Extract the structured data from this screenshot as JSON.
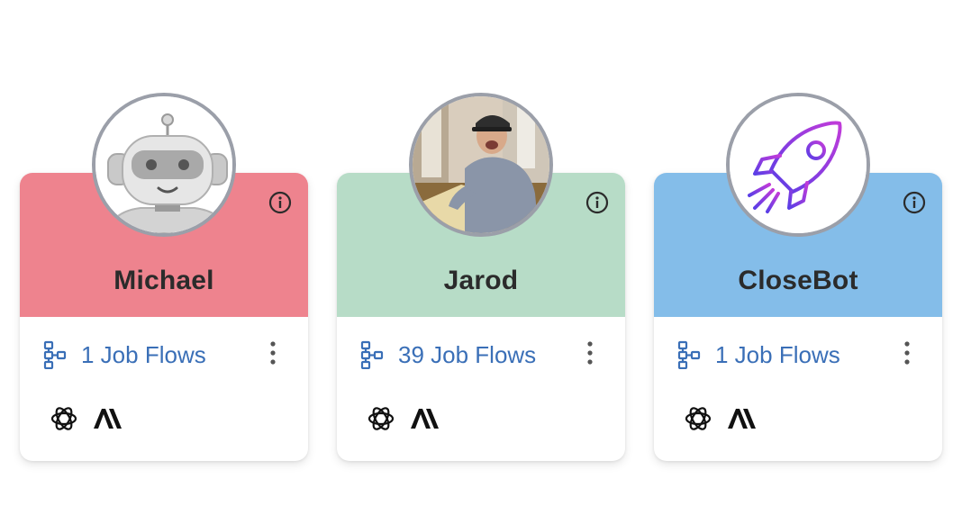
{
  "agents": [
    {
      "name": "Michael",
      "color": "#ee838e",
      "avatar": "robot-avatar",
      "job_flows": "1 Job Flows",
      "models": [
        "openai-icon",
        "anthropic-icon"
      ]
    },
    {
      "name": "Jarod",
      "color": "#b7dcc7",
      "avatar": "person-photo",
      "job_flows": "39 Job Flows",
      "models": [
        "openai-icon",
        "anthropic-icon"
      ]
    },
    {
      "name": "CloseBot",
      "color": "#84bde9",
      "avatar": "rocket-logo",
      "job_flows": "1 Job Flows",
      "models": [
        "openai-icon",
        "anthropic-icon"
      ]
    }
  ],
  "colors": {
    "link": "#3a6fb7",
    "avatar_border": "#9b9fa9",
    "rocket_gradient": [
      "#5a3ee6",
      "#c13bd9"
    ]
  }
}
